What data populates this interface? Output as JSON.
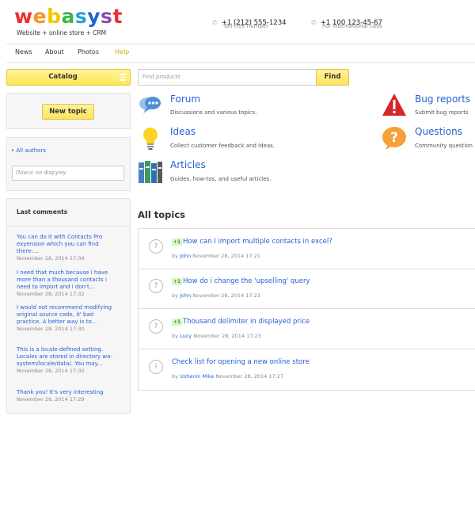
{
  "header": {
    "logo_letters": [
      "w",
      "e",
      "b",
      "a",
      "s",
      "y",
      "s",
      "t"
    ],
    "logo_colors": [
      "#e8322f",
      "#f7931e",
      "#f2c500",
      "#3cb54a",
      "#1e9fd9",
      "#2461d4",
      "#8b4aa8",
      "#e8322f"
    ],
    "tagline": "Website + online store + CRM",
    "phones": [
      {
        "number": "+1 (212) 555-1234",
        "label": "Toll-free number"
      },
      {
        "number": "+1 100 123-45-67",
        "label": "For international calls"
      }
    ]
  },
  "nav": {
    "items": [
      "News",
      "About",
      "Photos",
      "Help"
    ],
    "active_index": 3
  },
  "sidebar": {
    "catalog_label": "Catalog",
    "new_topic_label": "New topic",
    "all_authors_label": "All authors",
    "forum_search_placeholder": "Поиск по Форуму",
    "last_comments_title": "Last comments",
    "comments": [
      {
        "text": "You can do it with Contacts Pro exyension which you can find there:...",
        "date": "November 28, 2014 17:34"
      },
      {
        "text": "I need that much because i have more than a thousand contacts i need to import and i don't...",
        "date": "November 28, 2014 17:32"
      },
      {
        "text": "I would not recommend modifying original source code, it' bad practice. A better way is to...",
        "date": "November 28, 2014 17:30"
      },
      {
        "text": "This is a locale-defined setting. Locales are stored in directory wa-system/locale/data/. You may...",
        "date": "November 28, 2014 17:30"
      },
      {
        "text": "Thank you! It's very interesting",
        "date": "November 28, 2014 17:29"
      }
    ]
  },
  "search": {
    "placeholder": "Find products",
    "button_label": "Find"
  },
  "categories": [
    {
      "title": "Forum",
      "desc": "Discussions and various topics.",
      "icon": "chat-bubbles-icon"
    },
    {
      "title": "Ideas",
      "desc": "Collect customer feedback and ideas.",
      "icon": "lightbulb-icon"
    },
    {
      "title": "Articles",
      "desc": "Guides, how-tos, and useful articles.",
      "icon": "books-icon"
    },
    {
      "title": "Bug reports",
      "desc": "Submit bug reports",
      "icon": "warning-icon"
    },
    {
      "title": "Questions",
      "desc": "Community question",
      "icon": "question-icon"
    }
  ],
  "topics_section": {
    "title": "All topics",
    "by_label": "by",
    "topics": [
      {
        "title": "How can I import multiple contacts in excel?",
        "votes": "+1",
        "author": "John",
        "date": "November 28, 2014",
        "time": "17:21",
        "icon": "?"
      },
      {
        "title": "How do i change the 'upselling' query",
        "votes": "+1",
        "author": "John",
        "date": "November 28, 2014",
        "time": "17:23",
        "icon": "?"
      },
      {
        "title": "Thousand delimiter in displayed price",
        "votes": "+1",
        "author": "Lucy",
        "date": "November 28, 2014",
        "time": "17:23",
        "icon": "?"
      },
      {
        "title": "Check list for opening a new online store",
        "votes": "",
        "author": "Ushenin Mike",
        "date": "November 28, 2014",
        "time": "17:27",
        "icon": "i"
      }
    ]
  }
}
